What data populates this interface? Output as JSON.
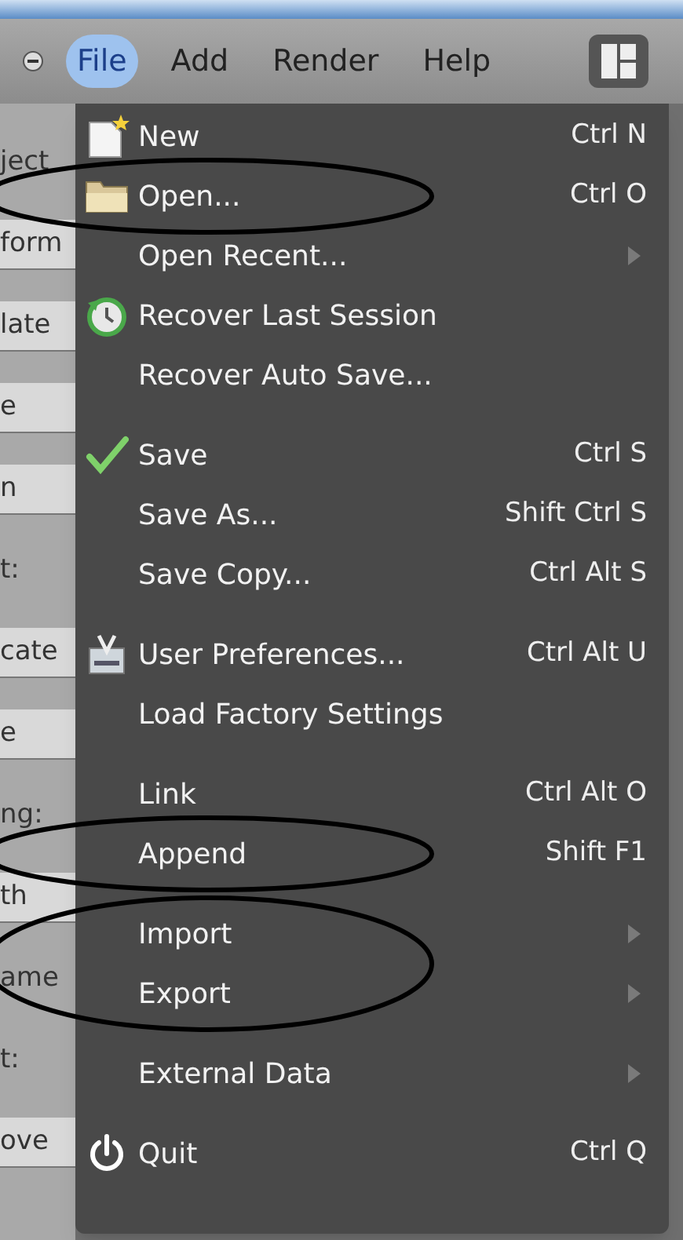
{
  "menu_bar": {
    "items": [
      {
        "label": "File",
        "selected": true
      },
      {
        "label": "Add",
        "selected": false
      },
      {
        "label": "Render",
        "selected": false
      },
      {
        "label": "Help",
        "selected": false
      }
    ]
  },
  "side_panel": {
    "items": [
      {
        "kind": "label",
        "text": "ject"
      },
      {
        "kind": "field",
        "text": "form"
      },
      {
        "kind": "field",
        "text": "late"
      },
      {
        "kind": "field",
        "text": "e"
      },
      {
        "kind": "field",
        "text": "n"
      },
      {
        "kind": "label",
        "text": "t:"
      },
      {
        "kind": "field",
        "text": "cate"
      },
      {
        "kind": "field",
        "text": "e"
      },
      {
        "kind": "label",
        "text": "ng:"
      },
      {
        "kind": "field",
        "text": "th"
      },
      {
        "kind": "label",
        "text": "ame"
      },
      {
        "kind": "label",
        "text": "t:"
      },
      {
        "kind": "field",
        "text": "ove"
      }
    ]
  },
  "file_menu": {
    "sections": [
      {
        "items": [
          {
            "kind": "new",
            "label": "New",
            "shortcut": "Ctrl N",
            "submenu": false,
            "circled": false
          },
          {
            "kind": "folder",
            "label": "Open...",
            "shortcut": "Ctrl O",
            "submenu": false,
            "circled": true
          },
          {
            "label": "Open Recent...",
            "submenu": true,
            "circled": false
          },
          {
            "kind": "recover",
            "label": "Recover Last Session",
            "submenu": false,
            "circled": false
          },
          {
            "label": "Recover Auto Save...",
            "submenu": false,
            "circled": false
          }
        ]
      },
      {
        "items": [
          {
            "kind": "check",
            "label": "Save",
            "shortcut": "Ctrl S",
            "submenu": false,
            "circled": false
          },
          {
            "label": "Save As...",
            "shortcut": "Shift Ctrl S",
            "submenu": false,
            "circled": false
          },
          {
            "label": "Save Copy...",
            "shortcut": "Ctrl Alt S",
            "submenu": false,
            "circled": false
          }
        ]
      },
      {
        "items": [
          {
            "kind": "prefs",
            "label": "User Preferences...",
            "shortcut": "Ctrl Alt U",
            "submenu": false,
            "circled": false
          },
          {
            "label": "Load Factory Settings",
            "submenu": false,
            "circled": false
          }
        ]
      },
      {
        "items": [
          {
            "label": "Link",
            "shortcut": "Ctrl Alt O",
            "submenu": false,
            "circled": false
          },
          {
            "label": "Append",
            "shortcut": "Shift F1",
            "submenu": false,
            "circled": true
          }
        ]
      },
      {
        "items": [
          {
            "label": "Import",
            "submenu": true,
            "circled": true
          },
          {
            "label": "Export",
            "submenu": true,
            "circled": true
          }
        ]
      },
      {
        "items": [
          {
            "label": "External Data",
            "submenu": true,
            "circled": false
          }
        ]
      },
      {
        "items": [
          {
            "kind": "power",
            "label": "Quit",
            "shortcut": "Ctrl Q",
            "submenu": false,
            "circled": false
          }
        ]
      }
    ]
  }
}
